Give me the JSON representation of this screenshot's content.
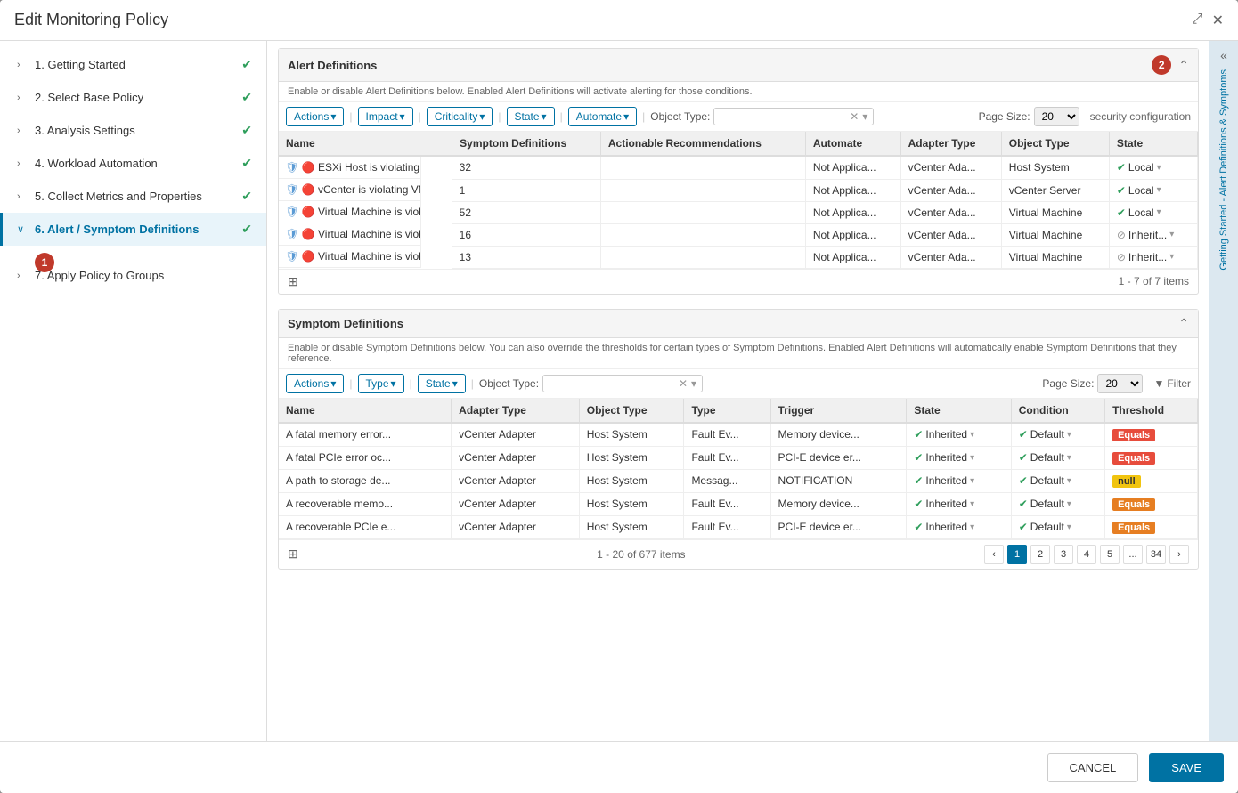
{
  "modal": {
    "title": "Edit Monitoring Policy",
    "cancel_label": "CANCEL",
    "save_label": "SAVE"
  },
  "sidebar": {
    "items": [
      {
        "id": "getting-started",
        "label": "1. Getting Started",
        "state": "collapsed",
        "checked": true
      },
      {
        "id": "select-base-policy",
        "label": "2. Select Base Policy",
        "state": "collapsed",
        "checked": true
      },
      {
        "id": "analysis-settings",
        "label": "3. Analysis Settings",
        "state": "collapsed",
        "checked": true
      },
      {
        "id": "workload-automation",
        "label": "4. Workload Automation",
        "state": "collapsed",
        "checked": true
      },
      {
        "id": "collect-metrics",
        "label": "5. Collect Metrics and Properties",
        "state": "collapsed",
        "checked": true
      },
      {
        "id": "alert-symptom",
        "label": "6. Alert / Symptom Definitions",
        "state": "expanded",
        "checked": true
      },
      {
        "id": "apply-policy",
        "label": "7. Apply Policy to Groups",
        "state": "collapsed",
        "checked": false
      }
    ]
  },
  "alert_definitions": {
    "section_title": "Alert Definitions",
    "section_desc": "Enable or disable Alert Definitions below. Enabled Alert Definitions will activate alerting for those conditions.",
    "filters": {
      "actions_label": "Actions",
      "impact_label": "Impact",
      "criticality_label": "Criticality",
      "state_label": "State",
      "automate_label": "Automate",
      "object_type_label": "Object Type:",
      "object_type_placeholder": "",
      "page_size_label": "Page Size:",
      "page_size_value": "20",
      "partial_label": "security configuration"
    },
    "columns": [
      "Name",
      "Symptom Definitions",
      "Actionable Recommendations",
      "Automate",
      "Adapter Type",
      "Object Type",
      "State"
    ],
    "rows": [
      {
        "name": "ESXi Host is violating V...",
        "symptoms": "32",
        "recommendations": "",
        "automate": "Not Applica...",
        "adapter": "vCenter Ada...",
        "object_type": "Host System",
        "state": "Local",
        "state_icon": "check"
      },
      {
        "name": "vCenter is violating VM...",
        "symptoms": "1",
        "recommendations": "",
        "automate": "Not Applica...",
        "adapter": "vCenter Ada...",
        "object_type": "vCenter Server",
        "state": "Local",
        "state_icon": "check"
      },
      {
        "name": "Virtual Machine is violat...",
        "symptoms": "52",
        "recommendations": "",
        "automate": "Not Applica...",
        "adapter": "vCenter Ada...",
        "object_type": "Virtual Machine",
        "state": "Local",
        "state_icon": "check"
      },
      {
        "name": "Virtual Machine is violat...",
        "symptoms": "16",
        "recommendations": "",
        "automate": "Not Applica...",
        "adapter": "vCenter Ada...",
        "object_type": "Virtual Machine",
        "state": "Inherit...",
        "state_icon": "inherit"
      },
      {
        "name": "Virtual Machine is violat...",
        "symptoms": "13",
        "recommendations": "",
        "automate": "Not Applica...",
        "adapter": "vCenter Ada...",
        "object_type": "Virtual Machine",
        "state": "Inherit...",
        "state_icon": "inherit"
      }
    ],
    "pagination": "1 - 7 of 7 items"
  },
  "symptom_definitions": {
    "section_title": "Symptom Definitions",
    "section_desc": "Enable or disable Symptom Definitions below. You can also override the thresholds for certain types of Symptom Definitions. Enabled Alert Definitions will automatically enable Symptom Definitions that they reference.",
    "filters": {
      "actions_label": "Actions",
      "type_label": "Type",
      "state_label": "State",
      "object_type_label": "Object Type:",
      "object_type_placeholder": "",
      "page_size_label": "Page Size:",
      "page_size_value": "20",
      "filter_label": "Filter"
    },
    "columns": [
      "Name",
      "Adapter Type",
      "Object Type",
      "Type",
      "Trigger",
      "State",
      "Condition",
      "Threshold"
    ],
    "rows": [
      {
        "name": "A fatal memory error...",
        "adapter": "vCenter Adapter",
        "object_type": "Host System",
        "type": "Fault Ev...",
        "trigger": "Memory device...",
        "state": "Inherited",
        "condition": "Default",
        "threshold": "Equals",
        "threshold_color": "red"
      },
      {
        "name": "A fatal PCIe error oc...",
        "adapter": "vCenter Adapter",
        "object_type": "Host System",
        "type": "Fault Ev...",
        "trigger": "PCI-E device er...",
        "state": "Inherited",
        "condition": "Default",
        "threshold": "Equals",
        "threshold_color": "red"
      },
      {
        "name": "A path to storage de...",
        "adapter": "vCenter Adapter",
        "object_type": "Host System",
        "type": "Messag...",
        "trigger": "NOTIFICATION",
        "state": "Inherited",
        "condition": "Default",
        "threshold": "null",
        "threshold_color": "yellow"
      },
      {
        "name": "A recoverable memo...",
        "adapter": "vCenter Adapter",
        "object_type": "Host System",
        "type": "Fault Ev...",
        "trigger": "Memory device...",
        "state": "Inherited",
        "condition": "Default",
        "threshold": "Equals",
        "threshold_color": "orange"
      },
      {
        "name": "A recoverable PCIe e...",
        "adapter": "vCenter Adapter",
        "object_type": "Host System",
        "type": "Fault Ev...",
        "trigger": "PCI-E device er...",
        "state": "Inherited",
        "condition": "Default",
        "threshold": "Equals",
        "threshold_color": "orange"
      }
    ],
    "pagination": "1 - 20 of 677 items",
    "pages": [
      "1",
      "2",
      "3",
      "4",
      "5",
      "...",
      "34"
    ]
  },
  "right_rail": {
    "label": "Getting Started - Alert Definitions & Symptoms"
  },
  "annotations": {
    "circle1": "1",
    "circle2": "2"
  }
}
